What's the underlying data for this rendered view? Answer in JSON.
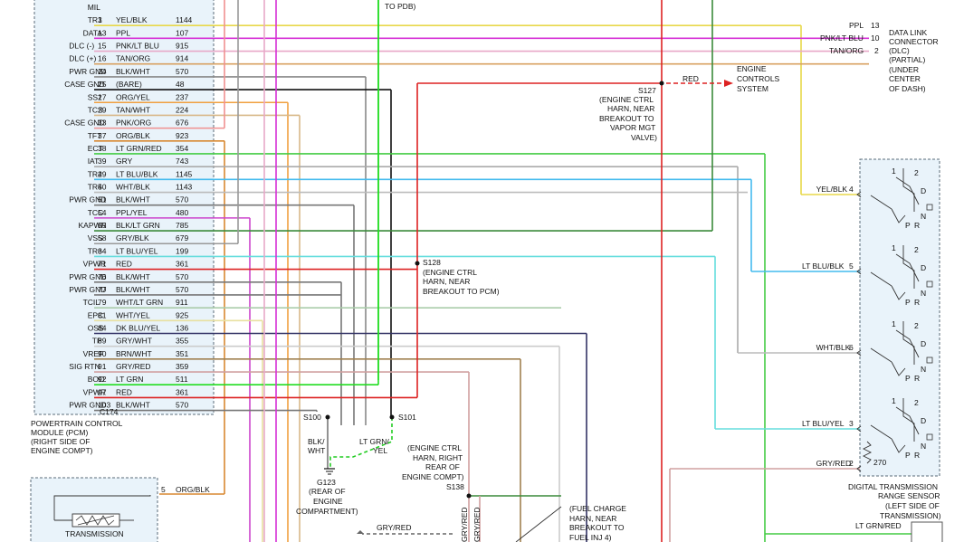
{
  "pcm": {
    "pins": [
      {
        "name": "MIL",
        "num": "",
        "circuit": "",
        "color_label": "",
        "wire_color": "#999999"
      },
      {
        "name": "TR1",
        "num": "3",
        "circuit": "1144",
        "color_label": "YEL/BLK",
        "wire_color": "#e8d84a"
      },
      {
        "name": "DATA",
        "num": "13",
        "circuit": "107",
        "color_label": "PPL",
        "wire_color": "#d630d6"
      },
      {
        "name": "DLC (-)",
        "num": "15",
        "circuit": "915",
        "color_label": "PNK/LT BLU",
        "wire_color": "#e8a8c8"
      },
      {
        "name": "DLC (+)",
        "num": "16",
        "circuit": "914",
        "color_label": "TAN/ORG",
        "wire_color": "#d8a060"
      },
      {
        "name": "PWR GND",
        "num": "24",
        "circuit": "570",
        "color_label": "BLK/WHT",
        "wire_color": "#888888"
      },
      {
        "name": "CASE GND",
        "num": "25",
        "circuit": "48",
        "color_label": "(BARE)",
        "wire_color": "#111111"
      },
      {
        "name": "SS1",
        "num": "27",
        "circuit": "237",
        "color_label": "ORG/YEL",
        "wire_color": "#f0a040"
      },
      {
        "name": "TCS",
        "num": "29",
        "circuit": "224",
        "color_label": "TAN/WHT",
        "wire_color": "#d8b888"
      },
      {
        "name": "CASE GND",
        "num": "33",
        "circuit": "676",
        "color_label": "PNK/ORG",
        "wire_color": "#f09090"
      },
      {
        "name": "TFT",
        "num": "37",
        "circuit": "923",
        "color_label": "ORG/BLK",
        "wire_color": "#d88830"
      },
      {
        "name": "ECT",
        "num": "38",
        "circuit": "354",
        "color_label": "LT GRN/RED",
        "wire_color": "#44cc44"
      },
      {
        "name": "IAT",
        "num": "39",
        "circuit": "743",
        "color_label": "GRY",
        "wire_color": "#aaaaaa"
      },
      {
        "name": "TR2",
        "num": "49",
        "circuit": "1145",
        "color_label": "LT BLU/BLK",
        "wire_color": "#44bbee"
      },
      {
        "name": "TR4",
        "num": "50",
        "circuit": "1143",
        "color_label": "WHT/BLK",
        "wire_color": "#bbbbbb"
      },
      {
        "name": "PWR GND",
        "num": "51",
        "circuit": "570",
        "color_label": "BLK/WHT",
        "wire_color": "#777777"
      },
      {
        "name": "TCC",
        "num": "54",
        "circuit": "480",
        "color_label": "PPL/YEL",
        "wire_color": "#cc44cc"
      },
      {
        "name": "KAPWR",
        "num": "55",
        "circuit": "785",
        "color_label": "BLK/LT GRN",
        "wire_color": "#3a8a3a"
      },
      {
        "name": "VSS",
        "num": "58",
        "circuit": "679",
        "color_label": "GRY/BLK",
        "wire_color": "#999999"
      },
      {
        "name": "TR3",
        "num": "64",
        "circuit": "199",
        "color_label": "LT BLU/YEL",
        "wire_color": "#66dddd"
      },
      {
        "name": "VPWR",
        "num": "71",
        "circuit": "361",
        "color_label": "RED",
        "wire_color": "#dd2222"
      },
      {
        "name": "PWR GND",
        "num": "76",
        "circuit": "570",
        "color_label": "BLK/WHT",
        "wire_color": "#777777"
      },
      {
        "name": "PWR GND",
        "num": "77",
        "circuit": "570",
        "color_label": "BLK/WHT",
        "wire_color": "#777777"
      },
      {
        "name": "TCIL",
        "num": "79",
        "circuit": "911",
        "color_label": "WHT/LT GRN",
        "wire_color": "#aaccaa"
      },
      {
        "name": "EPC",
        "num": "81",
        "circuit": "925",
        "color_label": "WHT/YEL",
        "wire_color": "#e8e0a0"
      },
      {
        "name": "OSS",
        "num": "84",
        "circuit": "136",
        "color_label": "DK BLU/YEL",
        "wire_color": "#333366"
      },
      {
        "name": "TP",
        "num": "89",
        "circuit": "355",
        "color_label": "GRY/WHT",
        "wire_color": "#cccccc"
      },
      {
        "name": "VREF",
        "num": "90",
        "circuit": "351",
        "color_label": "BRN/WHT",
        "wire_color": "#a08050"
      },
      {
        "name": "SIG RTN",
        "num": "91",
        "circuit": "359",
        "color_label": "GRY/RED",
        "wire_color": "#d0a0a0"
      },
      {
        "name": "BOO",
        "num": "92",
        "circuit": "511",
        "color_label": "LT GRN",
        "wire_color": "#22dd22"
      },
      {
        "name": "VPWR",
        "num": "97",
        "circuit": "361",
        "color_label": "RED",
        "wire_color": "#dd2222"
      },
      {
        "name": "PWR GND",
        "num": "103",
        "circuit": "570",
        "color_label": "BLK/WHT",
        "wire_color": "#777777"
      }
    ],
    "connector": "C174",
    "label": [
      "POWERTRAIN CONTROL",
      "MODULE (PCM)",
      "(RIGHT SIDE OF",
      "ENGINE COMPT)"
    ]
  },
  "dlc": {
    "wires": [
      {
        "color_label": "PPL",
        "pin": "13"
      },
      {
        "color_label": "PNK/LT BLU",
        "pin": "10"
      },
      {
        "color_label": "TAN/ORG",
        "pin": "2"
      }
    ],
    "label": [
      "DATA LINK",
      "CONNECTOR",
      "(DLC)",
      "(PARTIAL)",
      "(UNDER",
      "CENTER",
      "OF DASH)"
    ]
  },
  "splices": {
    "s127": {
      "id": "S127",
      "desc": [
        "(ENGINE CTRL",
        "HARN, NEAR",
        "BREAKOUT TO",
        "VAPOR MGT",
        "VALVE)"
      ],
      "wire": "RED",
      "target": [
        "ENGINE",
        "CONTROLS",
        "SYSTEM"
      ]
    },
    "s128": {
      "id": "S128",
      "desc": [
        "(ENGINE CTRL",
        "HARN, NEAR",
        "BREAKOUT TO PCM)"
      ]
    },
    "s100": {
      "id": "S100"
    },
    "s101": {
      "id": "S101"
    },
    "s138": {
      "id": "S138",
      "desc": [
        "(ENGINE CTRL",
        "HARN, RIGHT",
        "REAR OF",
        "ENGINE COMPT)"
      ]
    }
  },
  "ground": {
    "id": "G123",
    "desc": [
      "(REAR OF",
      "ENGINE",
      "COMPARTMENT)"
    ],
    "wire_left": [
      "BLK/",
      "WHT"
    ],
    "wire_right": [
      "LT GRN/",
      "YEL"
    ]
  },
  "range_sensor": {
    "inputs": [
      {
        "color_label": "YEL/BLK",
        "pin": "4"
      },
      {
        "color_label": "LT BLU/BLK",
        "pin": "5"
      },
      {
        "color_label": "WHT/BLK",
        "pin": "6"
      },
      {
        "color_label": "LT BLU/YEL",
        "pin": "3"
      },
      {
        "color_label": "GRY/RED",
        "pin": "2"
      }
    ],
    "resistor": "270",
    "positions": [
      "1",
      "2",
      "D",
      "N",
      "P",
      "R"
    ],
    "label": [
      "DIGITAL TRANSMISSION",
      "RANGE SENSOR",
      "(LEFT SIDE OF",
      "TRANSMISSION)"
    ],
    "bottom_wire": "LT GRN/RED"
  },
  "misc": {
    "pdb": "TO PDB)",
    "tft_pin": "5",
    "tft_wire": "ORG/BLK",
    "trans_label": "TRANSMISSION",
    "gry_red": "GRY/RED",
    "fuel": [
      "(FUEL CHARGE",
      "HARN, NEAR",
      "BREAKOUT TO",
      "FUEL INJ 4)"
    ],
    "vert_labels": [
      "GRY/RED",
      "GRY/RED"
    ]
  }
}
